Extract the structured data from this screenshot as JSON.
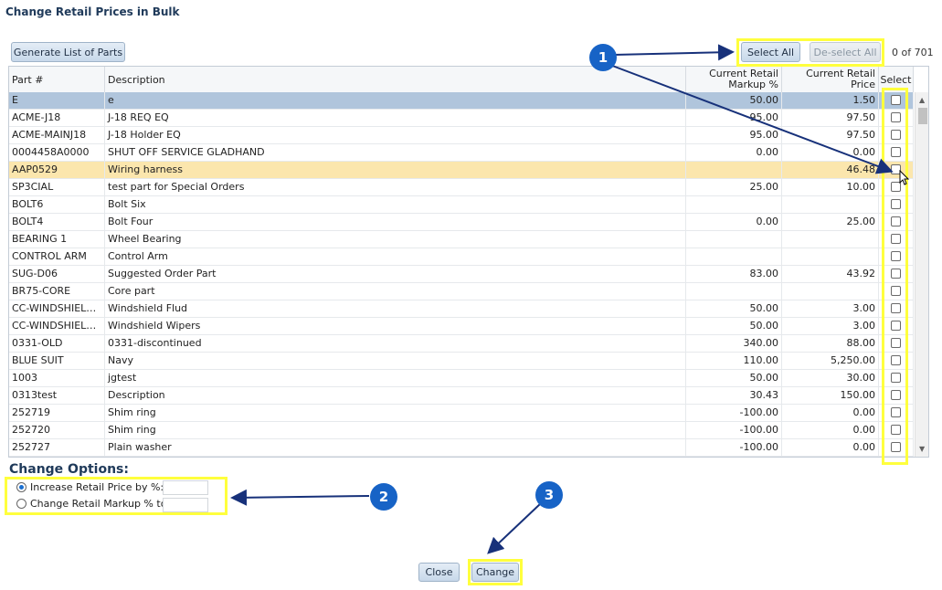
{
  "dialog": {
    "title": "Change Retail Prices in Bulk"
  },
  "toolbar": {
    "generate_label": "Generate List of Parts",
    "select_all_label": "Select All",
    "deselect_all_label": "De-select All",
    "count": "0 of 701"
  },
  "grid": {
    "headers": {
      "part": "Part #",
      "description": "Description",
      "markup_line1": "Current Retail",
      "markup_line2": "Markup %",
      "price": "Current Retail Price",
      "select": "Select"
    },
    "rows": [
      {
        "part": "E",
        "description": "e",
        "markup": "50.00",
        "price": "1.50",
        "state": "selected"
      },
      {
        "part": "ACME-J18",
        "description": "J-18 REQ EQ",
        "markup": "95.00",
        "price": "97.50",
        "state": ""
      },
      {
        "part": "ACME-MAINJ18",
        "description": "J-18 Holder EQ",
        "markup": "95.00",
        "price": "97.50",
        "state": ""
      },
      {
        "part": "0004458A0000",
        "description": "SHUT OFF SERVICE GLADHAND",
        "markup": "0.00",
        "price": "0.00",
        "state": ""
      },
      {
        "part": "AAP0529",
        "description": "Wiring harness",
        "markup": "",
        "price": "46.48",
        "state": "hover"
      },
      {
        "part": "SP3CIAL",
        "description": "test part for Special Orders",
        "markup": "25.00",
        "price": "10.00",
        "state": ""
      },
      {
        "part": "BOLT6",
        "description": "Bolt Six",
        "markup": "",
        "price": "",
        "state": ""
      },
      {
        "part": "BOLT4",
        "description": "Bolt Four",
        "markup": "0.00",
        "price": "25.00",
        "state": ""
      },
      {
        "part": "BEARING 1",
        "description": "Wheel Bearing",
        "markup": "",
        "price": "",
        "state": ""
      },
      {
        "part": "CONTROL ARM",
        "description": "Control Arm",
        "markup": "",
        "price": "",
        "state": ""
      },
      {
        "part": "SUG-D06",
        "description": "Suggested Order Part",
        "markup": "83.00",
        "price": "43.92",
        "state": ""
      },
      {
        "part": "BR75-CORE",
        "description": "Core part",
        "markup": "",
        "price": "",
        "state": ""
      },
      {
        "part": "CC-WINDSHIELDF...",
        "description": "Windshield Flud",
        "markup": "50.00",
        "price": "3.00",
        "state": ""
      },
      {
        "part": "CC-WINDSHIELD...",
        "description": "Windshield Wipers",
        "markup": "50.00",
        "price": "3.00",
        "state": ""
      },
      {
        "part": "0331-OLD",
        "description": "0331-discontinued",
        "markup": "340.00",
        "price": "88.00",
        "state": ""
      },
      {
        "part": "BLUE SUIT",
        "description": "Navy",
        "markup": "110.00",
        "price": "5,250.00",
        "state": ""
      },
      {
        "part": "1003",
        "description": "jgtest",
        "markup": "50.00",
        "price": "30.00",
        "state": ""
      },
      {
        "part": "0313test",
        "description": "Description",
        "markup": "30.43",
        "price": "150.00",
        "state": ""
      },
      {
        "part": "252719",
        "description": "Shim ring",
        "markup": "-100.00",
        "price": "0.00",
        "state": ""
      },
      {
        "part": "252720",
        "description": "Shim ring",
        "markup": "-100.00",
        "price": "0.00",
        "state": ""
      },
      {
        "part": "252727",
        "description": "Plain washer",
        "markup": "-100.00",
        "price": "0.00",
        "state": ""
      }
    ]
  },
  "options": {
    "title": "Change Options:",
    "increase_label": "Increase Retail Price by %:",
    "markup_label": "Change Retail Markup % to:",
    "selected": "increase"
  },
  "footer": {
    "close_label": "Close",
    "change_label": "Change"
  },
  "annotations": {
    "badge1": "1",
    "badge2": "2",
    "badge3": "3"
  },
  "colors": {
    "highlight": "#ffff3d",
    "badge": "#1763c6",
    "selected_row": "#b0c5dc",
    "hover_row": "#fbe6ad",
    "title": "#1f3a5a"
  }
}
